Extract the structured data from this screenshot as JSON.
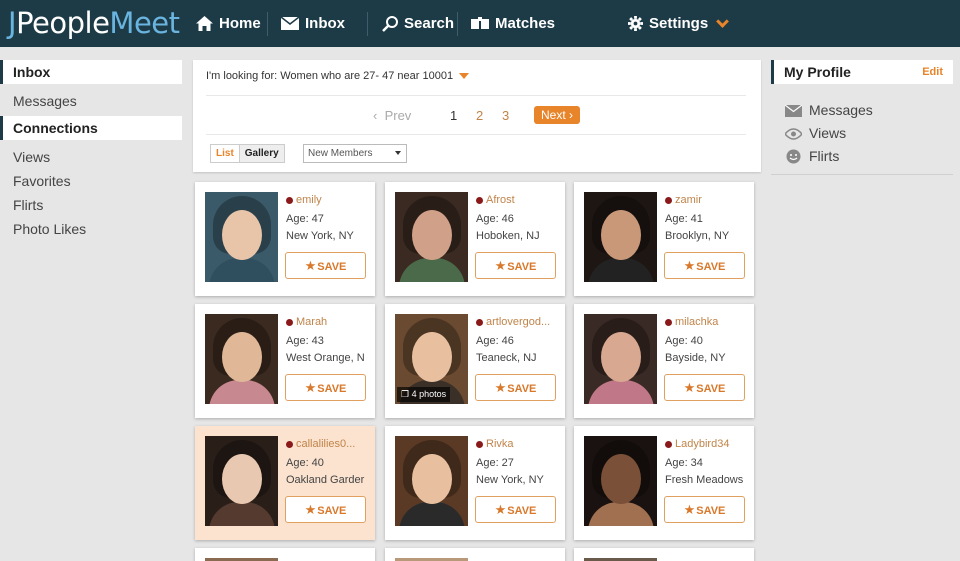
{
  "header": {
    "logo": {
      "j": "J",
      "people": "People",
      "meet": "Meet"
    },
    "nav": {
      "home": "Home",
      "inbox": "Inbox",
      "search": "Search",
      "matches": "Matches",
      "settings": "Settings"
    },
    "icons": [
      "home-icon",
      "envelope-icon",
      "search-icon",
      "matches-icon",
      "gear-icon",
      "chevron-down-icon"
    ]
  },
  "left_sidebar": {
    "inbox_heading": "Inbox",
    "inbox_items": [
      "Messages"
    ],
    "connections_heading": "Connections",
    "connections_items": [
      "Views",
      "Favorites",
      "Flirts",
      "Photo Likes"
    ]
  },
  "search_panel": {
    "looking_for": "I'm looking for: Women who are 27- 47 near 10001",
    "pagination": {
      "prev": "Prev",
      "pages": [
        "1",
        "2",
        "3"
      ],
      "current": "1",
      "next": "Next"
    },
    "view_tabs": [
      "List",
      "Gallery"
    ],
    "active_view": "Gallery",
    "sort_select": "New Members"
  },
  "members": [
    {
      "name": "emily",
      "age": "Age: 47",
      "location": "New York, NY",
      "save": "SAVE",
      "photos": "",
      "highlight": false
    },
    {
      "name": "Afrost",
      "age": "Age: 46",
      "location": "Hoboken, NJ",
      "save": "SAVE",
      "photos": "",
      "highlight": false
    },
    {
      "name": "zamir",
      "age": "Age: 41",
      "location": "Brooklyn, NY",
      "save": "SAVE",
      "photos": "",
      "highlight": false
    },
    {
      "name": "Marah",
      "age": "Age: 43",
      "location": "West Orange, N",
      "save": "SAVE",
      "photos": "",
      "highlight": false
    },
    {
      "name": "artlovergod...",
      "age": "Age: 46",
      "location": "Teaneck, NJ",
      "save": "SAVE",
      "photos": "4 photos",
      "highlight": false
    },
    {
      "name": "milachka",
      "age": "Age: 40",
      "location": "Bayside, NY",
      "save": "SAVE",
      "photos": "",
      "highlight": false
    },
    {
      "name": "callalilies0...",
      "age": "Age: 40",
      "location": "Oakland Garder",
      "save": "SAVE",
      "photos": "",
      "highlight": true
    },
    {
      "name": "Rivka",
      "age": "Age: 27",
      "location": "New York, NY",
      "save": "SAVE",
      "photos": "",
      "highlight": false
    },
    {
      "name": "Ladybird34",
      "age": "Age: 34",
      "location": "Fresh Meadows",
      "save": "SAVE",
      "photos": "",
      "highlight": false
    }
  ],
  "right_sidebar": {
    "heading": "My Profile",
    "edit": "Edit",
    "items": [
      {
        "label": "Messages",
        "icon": "envelope-icon"
      },
      {
        "label": "Views",
        "icon": "eye-icon"
      },
      {
        "label": "Flirts",
        "icon": "smiley-icon"
      }
    ]
  },
  "colors": {
    "header_bg": "#1d3b47",
    "accent": "#e8842a",
    "link": "#c0844a",
    "page_bg": "#e6e6e6",
    "highlight_card": "#fbe3cf"
  }
}
